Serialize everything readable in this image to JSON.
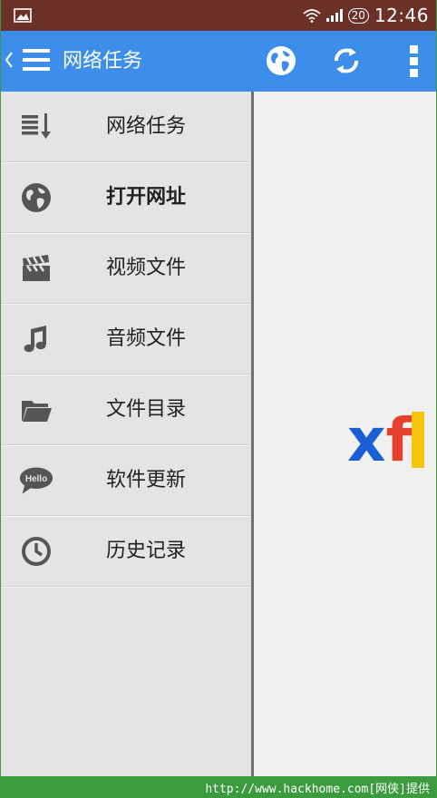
{
  "status_bar": {
    "left_icon": "image-icon",
    "wifi_icon": "wifi-icon",
    "signal_icon": "signal-icon",
    "badge": "20",
    "time": "12:46"
  },
  "toolbar": {
    "title": "网络任务",
    "icons": [
      "back-caret-icon",
      "menu-icon",
      "globe-icon",
      "sync-icon",
      "more-vertical-icon"
    ]
  },
  "drawer": {
    "items": [
      {
        "label": "网络任务",
        "icon": "task-list-icon"
      },
      {
        "label": "打开网址",
        "icon": "globe-icon",
        "active": true
      },
      {
        "label": "视频文件",
        "icon": "clapperboard-icon"
      },
      {
        "label": "音频文件",
        "icon": "music-note-icon"
      },
      {
        "label": "文件目录",
        "icon": "folder-icon"
      },
      {
        "label": "软件更新",
        "icon": "hello-bubble-icon",
        "icon_text": "Hello"
      },
      {
        "label": "历史记录",
        "icon": "clock-icon"
      }
    ]
  },
  "content": {
    "logo_text": "xf"
  },
  "footer": {
    "watermark": "http://www.hackhome.com[网侠]提供"
  },
  "colors": {
    "status_bar": "#6b3028",
    "toolbar": "#3d8eea",
    "drawer_bg": "#e4e4e4",
    "content_bg": "#f1f0ef",
    "footer": "#3c9a3f",
    "logo_blue": "#1b5fd6",
    "logo_red": "#e5412e",
    "logo_yellow": "#f5c40d"
  }
}
